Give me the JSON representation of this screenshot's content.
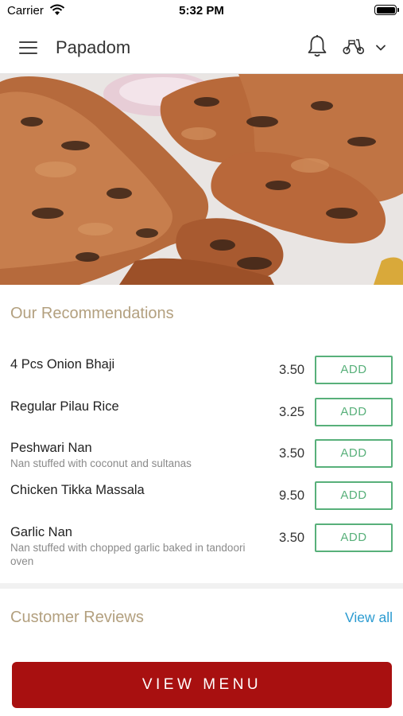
{
  "status_bar": {
    "carrier": "Carrier",
    "time": "5:32 PM"
  },
  "header": {
    "title": "Papadom",
    "icons": {
      "menu": "hamburger-menu-icon",
      "notifications": "bell-icon",
      "delivery": "scooter-icon",
      "dropdown": "chevron-down-icon"
    }
  },
  "hero": {
    "image": "tandoori-chicken-photo"
  },
  "recommendations": {
    "title": "Our Recommendations",
    "add_label": "ADD",
    "items": [
      {
        "name": "4 Pcs Onion Bhaji",
        "description": "",
        "price": "3.50"
      },
      {
        "name": "Regular Pilau Rice",
        "description": "",
        "price": "3.25"
      },
      {
        "name": "Peshwari Nan",
        "description": "Nan stuffed with coconut and sultanas",
        "price": "3.50"
      },
      {
        "name": "Chicken Tikka Massala",
        "description": "",
        "price": "9.50"
      },
      {
        "name": "Garlic Nan",
        "description": "Nan stuffed with chopped garlic baked in tandoori oven",
        "price": "3.50"
      }
    ]
  },
  "reviews": {
    "title": "Customer Reviews",
    "view_all": "View all"
  },
  "footer": {
    "view_menu": "VIEW MENU"
  },
  "colors": {
    "accent_gold": "#b3a07f",
    "add_green": "#58b07a",
    "link_blue": "#2b9bd1",
    "menu_red": "#a81010"
  }
}
